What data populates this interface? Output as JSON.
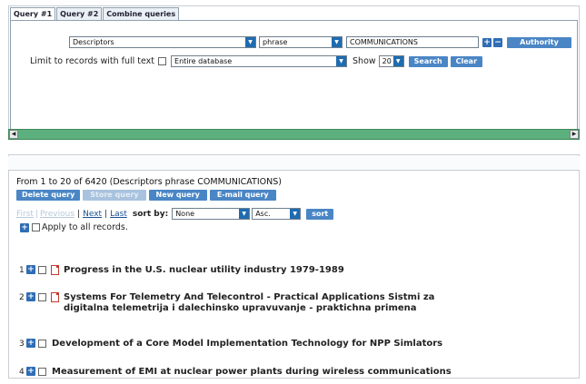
{
  "tabs": [
    {
      "label": "Query #1",
      "active": true
    },
    {
      "label": "Query #2",
      "active": false
    },
    {
      "label": "Combine queries",
      "active": false
    }
  ],
  "search": {
    "field": "Descriptors",
    "operator": "phrase",
    "term": "COMMUNICATIONS",
    "add_icon": "+",
    "remove_icon": "−",
    "authority_label": "Authority",
    "fulltext_label": "Limit to records with full text",
    "database": "Entire database",
    "show_label": "Show",
    "show_value": "20",
    "search_label": "Search",
    "clear_label": "Clear"
  },
  "scroll": {
    "left": "◀",
    "right": "▶"
  },
  "results": {
    "summary": "From 1 to 20 of 6420 (Descriptors phrase COMMUNICATIONS)",
    "actions": [
      {
        "label": "Delete query",
        "enabled": true
      },
      {
        "label": "Store query",
        "enabled": false
      },
      {
        "label": "New query",
        "enabled": true
      },
      {
        "label": "E-mail query",
        "enabled": true
      }
    ],
    "paging": {
      "first": "First",
      "previous": "Previous",
      "sep": "|",
      "next": "Next",
      "last": "Last",
      "sort_label": "sort by:",
      "sort_field": "None",
      "sort_order": "Asc.",
      "sort_button": "sort"
    },
    "apply_label": "Apply to all records.",
    "records": [
      {
        "num": "1",
        "title": "Progress in the U.S. nuclear utility industry 1979-1989",
        "pdf": true
      },
      {
        "num": "2",
        "title": "Systems For Telemetry And Telecontrol - Practical Applications Sistmi za",
        "title2": "digitalna telemetrija i dalechinsko upravuvanje - praktichna primena",
        "pdf": true
      },
      {
        "num": "3",
        "title": "Development of a Core Model Implementation Technology for NPP Simlators",
        "pdf": false
      },
      {
        "num": "4",
        "title": "Measurement of EMI at nuclear power plants during wireless communications",
        "pdf": false
      }
    ]
  }
}
